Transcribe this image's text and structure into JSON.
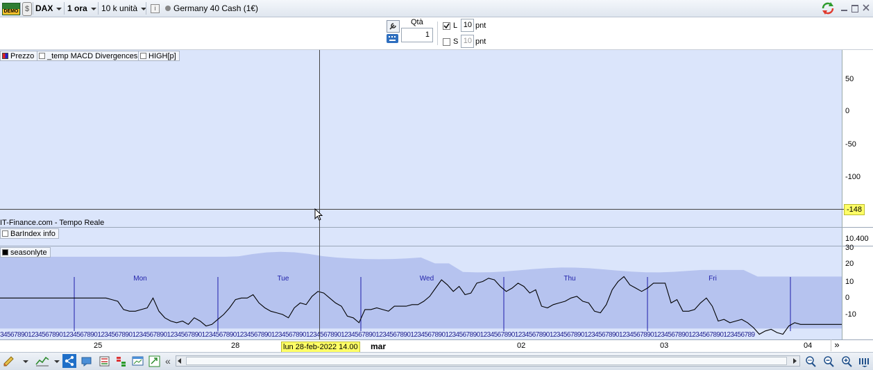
{
  "toolbar": {
    "demo_badge": "DEMO",
    "instrument": "DAX",
    "timeframe": "1 ora",
    "units": "10 k unità",
    "info_glyph": "i",
    "market_name": "Germany 40 Cash (1€)"
  },
  "order": {
    "qty_label": "Qtà",
    "qty_value": "1",
    "long_label": "L",
    "long_value": "10",
    "long_unit": "pnt",
    "short_label": "S",
    "short_value": "10",
    "short_unit": "pnt"
  },
  "price_panel": {
    "tags": [
      "Prezzo",
      "_temp MACD Divergences",
      "HIGH[p]"
    ],
    "y_ticks": [
      "50",
      "0",
      "-50",
      "-100"
    ],
    "cursor_value": "-148",
    "source_text": "IT-Finance.com - Tempo Reale"
  },
  "barindex_panel": {
    "tag": "BarIndex info",
    "y_tick": "10.400"
  },
  "season_panel": {
    "tag": "seasonlyte",
    "y_ticks": [
      "30",
      "20",
      "10",
      "0",
      "-10"
    ],
    "day_labels": [
      "Mon",
      "Tue",
      "Wed",
      "Thu",
      "Fri"
    ],
    "tick_digits": "3456789012345678901234567890123456789012345678901234567890123456789012345678901234567890123456789012345678901234567890123456789012345678901234567890123456789012345678901234567890123456789012345678901234567890123456789"
  },
  "x_axis": {
    "labels": [
      "25",
      "28",
      "mar",
      "02",
      "03",
      "04"
    ],
    "cursor_label": "lun 28-feb-2022 14.00",
    "more": "»"
  },
  "bottom": {
    "collapse": "«"
  },
  "colors": {
    "plot_bg": "#dbe5fb",
    "band": "#b6c3ef",
    "line": "#000000",
    "separator": "#1e1ea8",
    "cursor_tag": "#ffff66"
  },
  "chart_data": {
    "type": "line",
    "series": [
      {
        "values": [
          0,
          0,
          0,
          0,
          0,
          0,
          0,
          0,
          0,
          0,
          0,
          0,
          0,
          0,
          0,
          0,
          0,
          0,
          0,
          -1,
          -2,
          -7,
          -8,
          -8,
          -7,
          -6,
          0,
          -8,
          -12,
          -14,
          -15,
          -14,
          -16,
          -12,
          -14,
          -17,
          -16,
          -13,
          -10,
          -6,
          -1,
          0,
          0,
          2,
          -3,
          -6,
          -8,
          -9,
          -10,
          -12,
          -6,
          -3,
          -4,
          1,
          4,
          3,
          0,
          -3,
          -5,
          -11,
          -12,
          -15,
          -7,
          -7,
          -6,
          -7,
          -8,
          -5,
          -5,
          -5,
          -4,
          -4,
          -2,
          1,
          6,
          11,
          8,
          4,
          7,
          2,
          3,
          9,
          10,
          12,
          11,
          7,
          4,
          6,
          9,
          7,
          3,
          5,
          -5,
          -6,
          -4,
          -3,
          -2,
          0,
          1,
          -2,
          -3,
          -8,
          -9,
          -4,
          5,
          10,
          13,
          8,
          6,
          4,
          6,
          9,
          9,
          9,
          -3,
          -1,
          -8,
          -8,
          -7,
          -3,
          0,
          -5,
          -14,
          -13,
          -15,
          -14,
          -13,
          -15,
          -18,
          -22,
          -20,
          -19,
          -21,
          -22,
          -17,
          -15,
          -16,
          -16,
          -16,
          -16,
          -16,
          -16,
          -16,
          -16
        ]
      }
    ],
    "ylim": [
      -18,
      31
    ],
    "y_ticks": [
      30,
      20,
      10,
      0,
      -10
    ]
  }
}
